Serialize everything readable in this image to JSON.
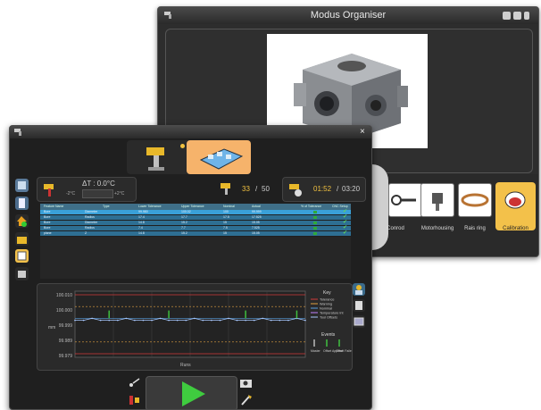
{
  "background_window": {
    "title": "Modus Organiser",
    "menu_items": [
      "Conrod",
      "Motorhousing",
      "Rais ring",
      "Calibration"
    ],
    "tile_icons": [
      "conrod-icon",
      "motorhousing-icon",
      "rais-ring-icon",
      "calibration-icon"
    ],
    "photo_subject": "machined-valve-body-icon",
    "cut_label": "ing"
  },
  "front_window": {
    "close_label": "×",
    "modes": [
      "probe-mode-icon",
      "fixture-mode-icon"
    ],
    "temperature": {
      "label": "ΔT : 0.0°C",
      "low": "-2°C",
      "high": "+2°C"
    },
    "counter": {
      "current": "33",
      "separator": "/",
      "total": "50"
    },
    "timer": {
      "elapsed": "01:52",
      "separator": "/",
      "total": "03:20"
    },
    "table": {
      "headers": [
        "Feature Name",
        "Type",
        "Lower Tolerance",
        "Upper Tolerance",
        "Nominal",
        "Actual",
        "% of Tolerance",
        "CNC Setup"
      ],
      "rows": [
        [
          "Bore",
          "Diameter",
          "99.980",
          "100.02",
          "100",
          "99.999"
        ],
        [
          "Bore",
          "Radius",
          "17.4",
          "17.7",
          "17.5",
          "17.525"
        ],
        [
          "Bore",
          "Diameter",
          "14.8",
          "15.2",
          "15",
          "15.05"
        ],
        [
          "Bore",
          "Radius",
          "7.4",
          "7.7",
          "7.5",
          "7.525"
        ],
        [
          "plane",
          "Z",
          "14.8",
          "15.2",
          "15",
          "15.05"
        ]
      ]
    },
    "chart": {
      "y_ticks": [
        "100.010",
        "100.000",
        "99.999",
        "99.989",
        "99.979"
      ],
      "y_label": "mm",
      "x_label": "Runs",
      "key_title": "Key",
      "key_items": [
        "Tolerance",
        "Warning",
        "Nominal",
        "Temperature Int",
        "Tool Offsets"
      ],
      "events_title": "Events",
      "events": [
        "Master",
        "Offset Applied",
        "Offset Failed"
      ]
    }
  },
  "chart_data": {
    "type": "line",
    "title": "",
    "xlabel": "Runs",
    "ylabel": "mm",
    "ylim": [
      99.979,
      100.015
    ],
    "y_ticks": [
      100.01,
      100.0,
      99.999,
      99.989,
      99.979
    ],
    "reference_lines": {
      "tolerance": [
        100.012,
        99.982
      ],
      "warning": [
        100.006,
        99.988
      ],
      "nominal": 100.0
    },
    "series": [
      {
        "name": "Tool Offsets",
        "values": [
          99.999,
          99.999,
          100.0,
          99.999,
          99.999,
          99.999,
          100.0,
          99.999,
          99.999,
          99.999,
          100.0,
          99.999,
          99.999,
          99.999,
          100.0,
          99.999,
          99.999,
          99.999,
          100.0,
          99.999,
          99.999,
          99.999,
          100.0,
          99.999,
          99.999,
          99.999,
          100.0,
          99.999
        ]
      }
    ],
    "events_at_runs": [
      4,
      11,
      20,
      26
    ],
    "legend": "right",
    "colors": {
      "tolerance": "#d33a3a",
      "warning": "#e0a040",
      "nominal": "#5aa0e0",
      "series": "#a8c8ff",
      "event": "#3fbf3f"
    }
  }
}
